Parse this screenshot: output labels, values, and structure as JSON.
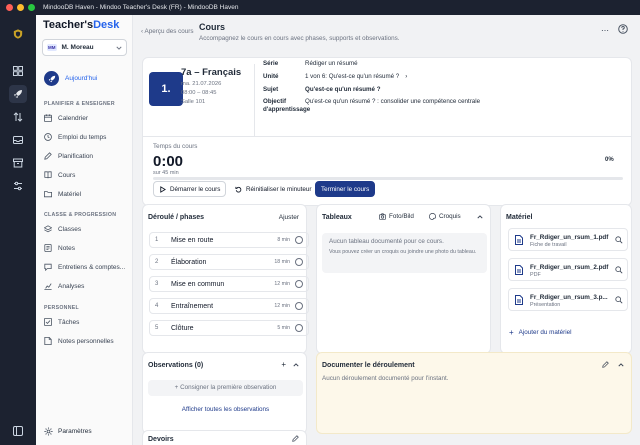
{
  "window": {
    "title": "MindooDB Haven - Mindoo Teacher's Desk (FR) - MindooDB Haven"
  },
  "app": {
    "brand_main": "Teacher's",
    "brand_accent": "Desk"
  },
  "user": {
    "initials": "MM",
    "name": "M. Moreau"
  },
  "sidebar": {
    "today_label": "Aujourd'hui",
    "section1": "PLANIFIER & ENSEIGNER",
    "section2": "CLASSE & PROGRESSION",
    "section3": "PERSONNEL",
    "items": [
      {
        "label": "Calendrier",
        "icon": "calendar-icon"
      },
      {
        "label": "Emploi du temps",
        "icon": "clock-icon"
      },
      {
        "label": "Planification",
        "icon": "edit-icon"
      },
      {
        "label": "Cours",
        "icon": "book-icon"
      },
      {
        "label": "Matériel",
        "icon": "folder-icon"
      },
      {
        "label": "Classes",
        "icon": "layers-icon"
      },
      {
        "label": "Notes",
        "icon": "grades-icon"
      },
      {
        "label": "Entretiens & comptes...",
        "icon": "chat-icon"
      },
      {
        "label": "Analyses",
        "icon": "chart-icon"
      },
      {
        "label": "Tâches",
        "icon": "checklist-icon"
      },
      {
        "label": "Notes personnelles",
        "icon": "note-icon"
      }
    ],
    "settings_label": "Paramètres"
  },
  "header": {
    "breadcrumb": "‹ Aperçu des cours",
    "title": "Cours",
    "subtitle": "Accompagnez le cours en cours avec phases, supports et observations."
  },
  "lesson": {
    "number": "1.",
    "title": "7a – Français",
    "date": "ma. 21.07.2026",
    "time": "08:00 – 08:45",
    "room": "Salle 101",
    "fields": [
      {
        "key": "Série",
        "value": "Rédiger un résumé"
      },
      {
        "key": "Unité",
        "value": "1 von 6: Qu'est-ce qu'un résumé ?"
      },
      {
        "key": "Sujet",
        "value": "Qu'est-ce qu'un résumé ?"
      },
      {
        "key": "Objectif d'apprentissage",
        "value": "Qu'est-ce qu'un résumé ? : consolider une compétence centrale"
      }
    ]
  },
  "timer": {
    "label": "Temps du cours",
    "value": "0:00",
    "sub": "sur 45 min",
    "percent": "0%",
    "progress": 0,
    "start_label": "Démarrer le cours",
    "reset_label": "Réinitialiser le minuteur",
    "finish_label": "Terminer le cours"
  },
  "phases": {
    "title": "Déroulé / phases",
    "add_label": "Ajuster",
    "items": [
      {
        "num": "1",
        "name": "Mise en route",
        "duration": "8 min"
      },
      {
        "num": "2",
        "name": "Élaboration",
        "duration": "18 min"
      },
      {
        "num": "3",
        "name": "Mise en commun",
        "duration": "12 min"
      },
      {
        "num": "4",
        "name": "Entraînement",
        "duration": "12 min"
      },
      {
        "num": "5",
        "name": "Clôture",
        "duration": "5 min"
      }
    ]
  },
  "boards": {
    "title": "Tableaux",
    "photo_label": "Foto/Bild",
    "sketch_label": "Croquis",
    "empty_title": "Aucun tableau documenté pour ce cours.",
    "empty_hint": "Vous pouvez créer un croquis ou joindre une photo du tableau."
  },
  "materials": {
    "title": "Matériel",
    "items": [
      {
        "name": "Fr_Rdiger_un_rsum_1.pdf",
        "type": "Fiche de travail"
      },
      {
        "name": "Fr_Rdiger_un_rsum_2.pdf",
        "type": "PDF"
      },
      {
        "name": "Fr_Rdiger_un_rsum_3.p...",
        "type": "Présentation"
      }
    ],
    "add_label": "Ajouter du matériel"
  },
  "observations": {
    "title": "Observations (0)",
    "placeholder": "Consigner la première observation",
    "show_all": "Afficher toutes les observations"
  },
  "documentation": {
    "title": "Documenter le déroulement",
    "empty": "Aucun déroulement documenté pour l'instant."
  },
  "homework": {
    "title": "Devoirs"
  },
  "colors": {
    "primary": "#1e3a8a",
    "accent": "#2563eb",
    "rail": "#1c2230",
    "doc_bg": "#fdf8ea"
  }
}
